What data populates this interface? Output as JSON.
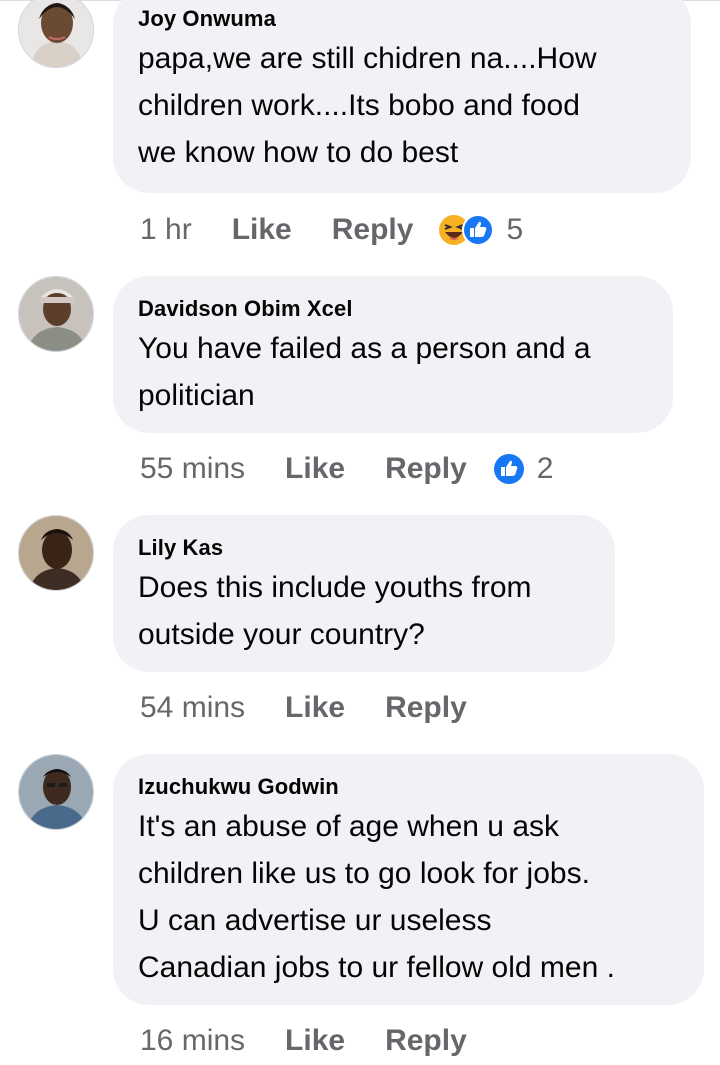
{
  "comments": [
    {
      "author": "Joy Onwuma",
      "lines": [
        "papa,we are still chidren na....How",
        "children work....Its bobo and food",
        "we know how to do best"
      ],
      "time": "1 hr",
      "like_label": "Like",
      "reply_label": "Reply",
      "reactions": [
        "haha-icon",
        "like-icon"
      ],
      "reaction_count": "5"
    },
    {
      "author": "Davidson Obim Xcel",
      "lines": [
        "You have failed as a person and a",
        "politician"
      ],
      "time": "55 mins",
      "like_label": "Like",
      "reply_label": "Reply",
      "reactions": [
        "like-icon"
      ],
      "reaction_count": "2"
    },
    {
      "author": "Lily Kas",
      "lines": [
        "Does this include youths from",
        "outside your country?"
      ],
      "time": "54 mins",
      "like_label": "Like",
      "reply_label": "Reply"
    },
    {
      "author": "Izuchukwu Godwin",
      "lines": [
        "It's an abuse of age when u ask",
        "children like us to go look for jobs.",
        "U can advertise ur useless",
        "Canadian jobs to ur fellow old men ."
      ],
      "time": "16 mins",
      "like_label": "Like",
      "reply_label": "Reply"
    }
  ],
  "colors": {
    "bubble": "#f0f2f5",
    "meta_text": "#65676b",
    "like_blue": "#1877f2",
    "haha_yellow": "#f7b125"
  }
}
